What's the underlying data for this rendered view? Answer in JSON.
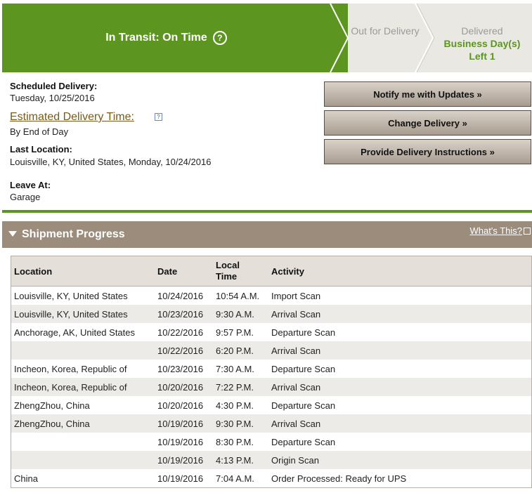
{
  "status": {
    "current_stage": "In Transit: On Time",
    "help_icon": "help-circle-icon",
    "next_stage": "Out for Delivery",
    "final_stage_label": "Delivered",
    "final_stage_days": "Business Day(s) Left 1"
  },
  "summary": {
    "scheduled_label": "Scheduled Delivery:",
    "scheduled_value": "Tuesday, 10/25/2016",
    "estimated_label": "Estimated Delivery Time:",
    "estimated_value": "By End of Day",
    "last_location_label": "Last Location:",
    "last_location_value": "Louisville, KY, United States, Monday, 10/24/2016",
    "leave_at_label": "Leave At:",
    "leave_at_value": "Garage"
  },
  "actions": {
    "notify": "Notify me with Updates »",
    "change": "Change Delivery »",
    "instructions": "Provide Delivery Instructions »"
  },
  "progress": {
    "title": "Shipment Progress",
    "whats_this": "What's This?",
    "columns": [
      "Location",
      "Date",
      "Local Time",
      "Activity"
    ],
    "rows": [
      [
        "Louisville, KY, United States",
        "10/24/2016",
        "10:54 A.M.",
        "Import Scan"
      ],
      [
        "Louisville, KY, United States",
        "10/23/2016",
        "9:30 A.M.",
        "Arrival Scan"
      ],
      [
        "Anchorage, AK, United States",
        "10/22/2016",
        "9:57 P.M.",
        "Departure Scan"
      ],
      [
        "",
        "10/22/2016",
        "6:20 P.M.",
        "Arrival Scan"
      ],
      [
        "Incheon, Korea, Republic of",
        "10/23/2016",
        "7:30 A.M.",
        "Departure Scan"
      ],
      [
        "Incheon, Korea, Republic of",
        "10/20/2016",
        "7:22 P.M.",
        "Arrival Scan"
      ],
      [
        "ZhengZhou, China",
        "10/20/2016",
        "4:30 P.M.",
        "Departure Scan"
      ],
      [
        "ZhengZhou, China",
        "10/19/2016",
        "9:30 P.M.",
        "Arrival Scan"
      ],
      [
        "",
        "10/19/2016",
        "8:30 P.M.",
        "Departure Scan"
      ],
      [
        "",
        "10/19/2016",
        "4:13 P.M.",
        "Origin Scan"
      ],
      [
        "China",
        "10/19/2016",
        "7:04 A.M.",
        "Order Processed: Ready for UPS"
      ]
    ]
  }
}
